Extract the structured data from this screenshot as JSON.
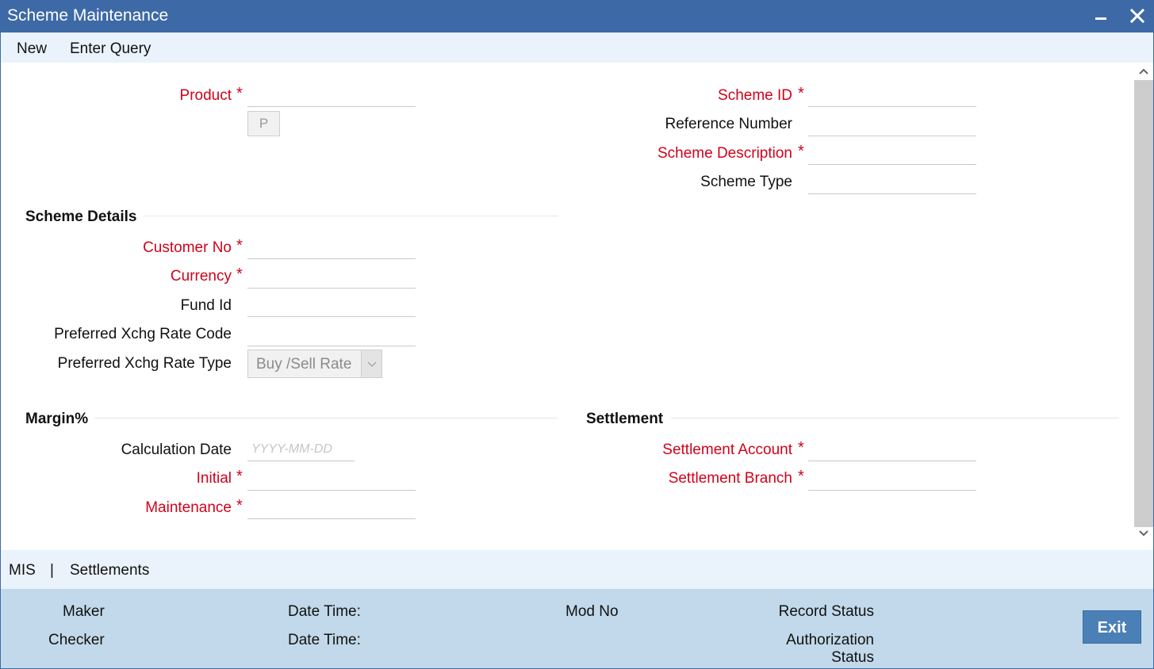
{
  "window": {
    "title": "Scheme Maintenance",
    "minimize_icon": "minimize-icon",
    "close_icon": "close-icon"
  },
  "toolbar": {
    "new_label": "New",
    "enter_query_label": "Enter Query"
  },
  "form": {
    "product_label": "Product",
    "product_button_label": "P",
    "scheme_id_label": "Scheme ID",
    "reference_number_label": "Reference Number",
    "scheme_description_label": "Scheme Description",
    "scheme_type_label": "Scheme Type",
    "required_marker": "*"
  },
  "scheme_details": {
    "heading": "Scheme Details",
    "customer_no_label": "Customer No",
    "currency_label": "Currency",
    "fund_id_label": "Fund Id",
    "xchg_rate_code_label": "Preferred Xchg Rate Code",
    "xchg_rate_type_label": "Preferred Xchg Rate Type",
    "xchg_rate_type_value": "Buy /Sell Rate"
  },
  "margin": {
    "heading": "Margin%",
    "calculation_date_label": "Calculation Date",
    "calculation_date_placeholder": "YYYY-MM-DD",
    "initial_label": "Initial",
    "maintenance_label": "Maintenance"
  },
  "settlement": {
    "heading": "Settlement",
    "account_label": "Settlement Account",
    "branch_label": "Settlement Branch"
  },
  "tabs": {
    "mis": "MIS",
    "separator": "|",
    "settlements": "Settlements"
  },
  "footer": {
    "maker": "Maker",
    "checker": "Checker",
    "date_time_1": "Date Time:",
    "date_time_2": "Date Time:",
    "mod_no": "Mod No",
    "record_status": "Record Status",
    "authorization_line1": "Authorization",
    "authorization_line2": "Status",
    "exit_label": "Exit"
  },
  "colors": {
    "titlebar": "#3d6aa6",
    "required": "#d0021b",
    "footer": "#c1d9ea",
    "exit_button": "#4a80b6"
  }
}
